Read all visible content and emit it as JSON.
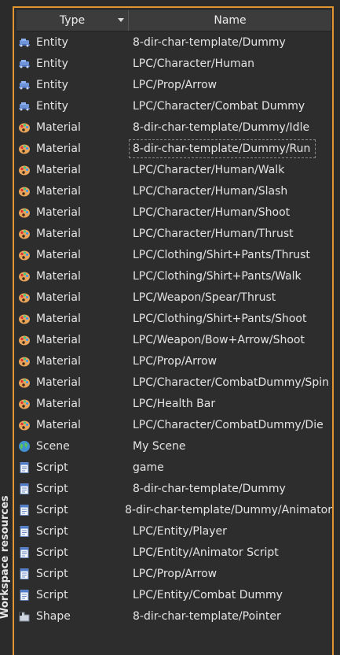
{
  "side_tab": {
    "label": "Workspace resources"
  },
  "columns": {
    "type": "Type",
    "name": "Name"
  },
  "colors": {
    "panel_border": "#e0952e",
    "background": "#2d2d2d"
  },
  "rows": [
    {
      "type": "Entity",
      "name": "8-dir-char-template/Dummy",
      "icon": "entity-icon"
    },
    {
      "type": "Entity",
      "name": "LPC/Character/Human",
      "icon": "entity-icon"
    },
    {
      "type": "Entity",
      "name": "LPC/Prop/Arrow",
      "icon": "entity-icon"
    },
    {
      "type": "Entity",
      "name": "LPC/Character/Combat Dummy",
      "icon": "entity-icon"
    },
    {
      "type": "Material",
      "name": "8-dir-char-template/Dummy/Idle",
      "icon": "material-icon"
    },
    {
      "type": "Material",
      "name": "8-dir-char-template/Dummy/Run",
      "icon": "material-icon",
      "focused": true
    },
    {
      "type": "Material",
      "name": "LPC/Character/Human/Walk",
      "icon": "material-icon"
    },
    {
      "type": "Material",
      "name": "LPC/Character/Human/Slash",
      "icon": "material-icon"
    },
    {
      "type": "Material",
      "name": "LPC/Character/Human/Shoot",
      "icon": "material-icon"
    },
    {
      "type": "Material",
      "name": "LPC/Character/Human/Thrust",
      "icon": "material-icon"
    },
    {
      "type": "Material",
      "name": "LPC/Clothing/Shirt+Pants/Thrust",
      "icon": "material-icon"
    },
    {
      "type": "Material",
      "name": "LPC/Clothing/Shirt+Pants/Walk",
      "icon": "material-icon"
    },
    {
      "type": "Material",
      "name": "LPC/Weapon/Spear/Thrust",
      "icon": "material-icon"
    },
    {
      "type": "Material",
      "name": "LPC/Clothing/Shirt+Pants/Shoot",
      "icon": "material-icon"
    },
    {
      "type": "Material",
      "name": "LPC/Weapon/Bow+Arrow/Shoot",
      "icon": "material-icon"
    },
    {
      "type": "Material",
      "name": "LPC/Prop/Arrow",
      "icon": "material-icon"
    },
    {
      "type": "Material",
      "name": "LPC/Character/CombatDummy/Spin",
      "icon": "material-icon"
    },
    {
      "type": "Material",
      "name": "LPC/Health Bar",
      "icon": "material-icon"
    },
    {
      "type": "Material",
      "name": "LPC/Character/CombatDummy/Die",
      "icon": "material-icon"
    },
    {
      "type": "Scene",
      "name": "My Scene",
      "icon": "scene-icon"
    },
    {
      "type": "Script",
      "name": "game",
      "icon": "script-icon"
    },
    {
      "type": "Script",
      "name": "8-dir-char-template/Dummy",
      "icon": "script-icon"
    },
    {
      "type": "Script",
      "name": "8-dir-char-template/Dummy/Animator",
      "icon": "script-icon"
    },
    {
      "type": "Script",
      "name": "LPC/Entity/Player",
      "icon": "script-icon"
    },
    {
      "type": "Script",
      "name": "LPC/Entity/Animator Script",
      "icon": "script-icon"
    },
    {
      "type": "Script",
      "name": "LPC/Prop/Arrow",
      "icon": "script-icon"
    },
    {
      "type": "Script",
      "name": "LPC/Entity/Combat Dummy",
      "icon": "script-icon"
    },
    {
      "type": "Shape",
      "name": "8-dir-char-template/Pointer",
      "icon": "shape-icon"
    }
  ]
}
